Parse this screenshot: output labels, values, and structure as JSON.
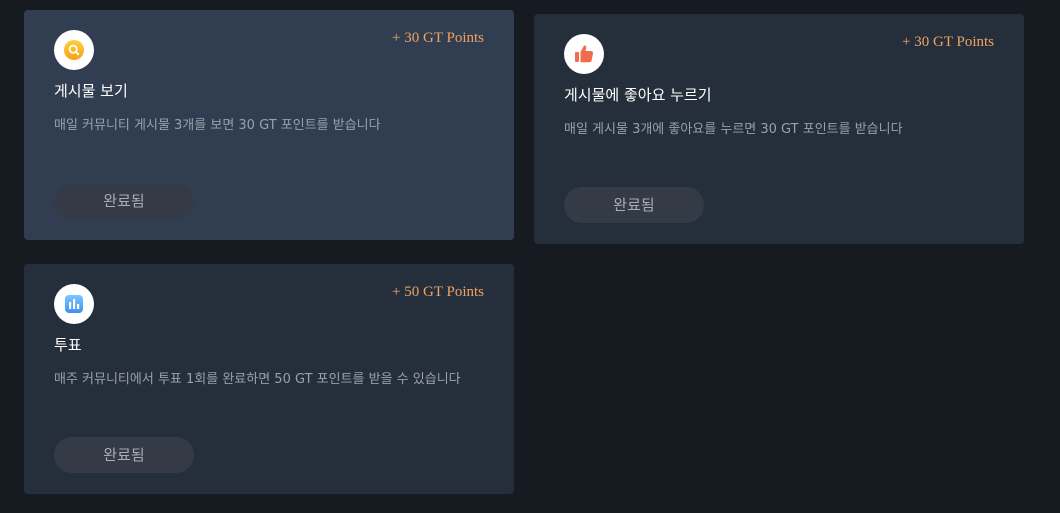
{
  "tasks": [
    {
      "points": "+ 30 GT Points",
      "title": "게시물 보기",
      "description": "매일 커뮤니티 게시물 3개를 보면 30 GT 포인트를 받습니다",
      "button": "완료됨",
      "icon": "magnifier-icon"
    },
    {
      "points": "+ 30 GT Points",
      "title": "게시물에 좋아요 누르기",
      "description": "매일 게시물 3개에 좋아요를 누르면 30 GT 포인트를 받습니다",
      "button": "완료됨",
      "icon": "thumbs-up-icon"
    },
    {
      "points": "+ 50 GT Points",
      "title": "투표",
      "description": "매주 커뮤니티에서 투표 1회를 완료하면 50 GT 포인트를 받을 수 있습니다",
      "button": "완료됨",
      "icon": "bar-chart-icon"
    }
  ],
  "colors": {
    "background": "#161b22",
    "card": "#252f3c",
    "card_hover": "#313e51",
    "points": "#f0a25e",
    "button": "#343b47"
  }
}
